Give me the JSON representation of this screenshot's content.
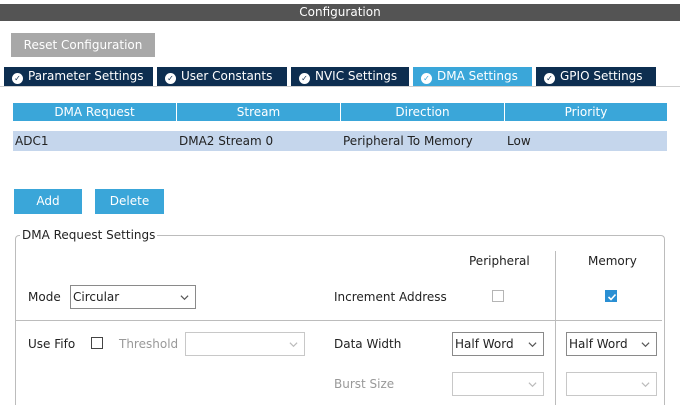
{
  "window": {
    "title": "Configuration"
  },
  "toolbar": {
    "reset_label": "Reset Configuration"
  },
  "tabs": [
    {
      "label": "Parameter Settings",
      "icon": "check-circle-icon",
      "active": false
    },
    {
      "label": "User Constants",
      "icon": "check-circle-icon",
      "active": false
    },
    {
      "label": "NVIC Settings",
      "icon": "check-circle-icon",
      "active": false
    },
    {
      "label": "DMA Settings",
      "icon": "check-circle-icon",
      "active": true
    },
    {
      "label": "GPIO Settings",
      "icon": "check-circle-icon",
      "active": false
    }
  ],
  "table": {
    "columns": [
      "DMA Request",
      "Stream",
      "Direction",
      "Priority"
    ],
    "rows": [
      {
        "request": "ADC1",
        "stream": "DMA2 Stream 0",
        "direction": "Peripheral To Memory",
        "priority": "Low"
      }
    ]
  },
  "actions": {
    "add_label": "Add",
    "delete_label": "Delete"
  },
  "settings": {
    "legend": "DMA Request Settings",
    "peripheral_header": "Peripheral",
    "memory_header": "Memory",
    "mode_label": "Mode",
    "mode_value": "Circular",
    "increment_label": "Increment Address",
    "increment_peripheral": false,
    "increment_memory": true,
    "use_fifo_label": "Use Fifo",
    "use_fifo": false,
    "threshold_label": "Threshold",
    "threshold_value": "",
    "data_width_label": "Data Width",
    "data_width_peripheral": "Half Word",
    "data_width_memory": "Half Word",
    "burst_size_label": "Burst Size",
    "burst_peripheral": "",
    "burst_memory": ""
  },
  "colors": {
    "accent": "#3aa6d9",
    "tab_inactive": "#0d2e50",
    "row_selected": "#c5d6ec",
    "title_bar": "#545454",
    "button_gray": "#a8a8a8"
  }
}
